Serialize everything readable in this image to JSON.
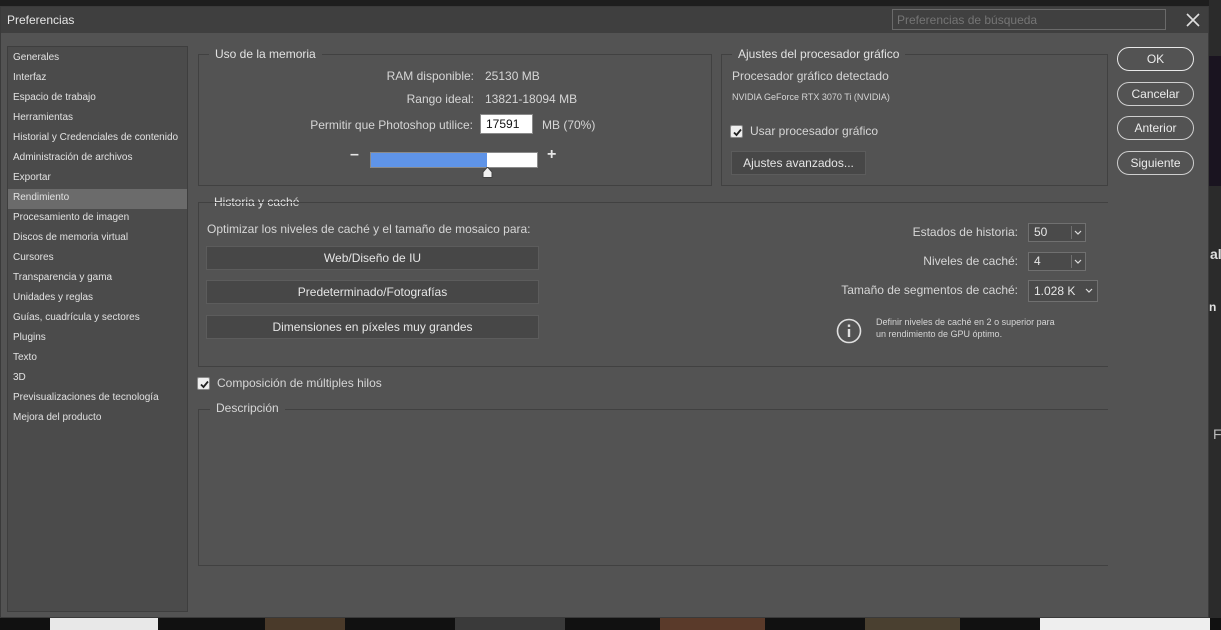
{
  "window": {
    "title": "Preferencias"
  },
  "search": {
    "placeholder": "Preferencias de búsqueda"
  },
  "sidebar": {
    "items": [
      {
        "label": "Generales"
      },
      {
        "label": "Interfaz"
      },
      {
        "label": "Espacio de trabajo"
      },
      {
        "label": "Herramientas"
      },
      {
        "label": "Historial y Credenciales de contenido"
      },
      {
        "label": "Administración de archivos"
      },
      {
        "label": "Exportar"
      },
      {
        "label": "Rendimiento",
        "selected": true
      },
      {
        "label": "Procesamiento de imagen"
      },
      {
        "label": "Discos de memoria virtual"
      },
      {
        "label": "Cursores"
      },
      {
        "label": "Transparencia y gama"
      },
      {
        "label": "Unidades y reglas"
      },
      {
        "label": "Guías, cuadrícula y sectores"
      },
      {
        "label": "Plugins"
      },
      {
        "label": "Texto"
      },
      {
        "label": "3D"
      },
      {
        "label": "Previsualizaciones de tecnología"
      },
      {
        "label": "Mejora del producto"
      }
    ]
  },
  "memory": {
    "title": "Uso de la memoria",
    "ram_label": "RAM disponible:",
    "ram_value": "25130 MB",
    "ideal_label": "Rango ideal:",
    "ideal_value": "13821-18094 MB",
    "allow_label": "Permitir que Photoshop utilice:",
    "allow_value": "17591",
    "allow_unit": "MB (70%)",
    "slider_fraction": 0.7,
    "minus": "–",
    "plus": "+"
  },
  "gpu": {
    "title": "Ajustes del procesador gráfico",
    "detected_label": "Procesador gráfico detectado",
    "gpu_name": "NVIDIA GeForce RTX 3070 Ti (NVIDIA)",
    "use_gpu_label": "Usar procesador gráfico",
    "use_gpu_checked": true,
    "advanced_button": "Ajustes avanzados..."
  },
  "history": {
    "title": "Historia y caché",
    "optimize_label": "Optimizar los niveles de caché y el tamaño de mosaico para:",
    "buttons": [
      "Web/Diseño de IU",
      "Predeterminado/Fotografías",
      "Dimensiones en píxeles muy grandes"
    ],
    "states_label": "Estados de historia:",
    "states_value": "50",
    "cache_levels_label": "Niveles de caché:",
    "cache_levels_value": "4",
    "tile_size_label": "Tamaño de segmentos de caché:",
    "tile_size_value": "1.028 K",
    "info_text": "Definir niveles de caché en 2 o superior para un rendimiento de GPU óptimo."
  },
  "multithread": {
    "label": "Composición de múltiples hilos",
    "checked": true
  },
  "description": {
    "title": "Descripción"
  },
  "actions": {
    "ok": "OK",
    "cancel": "Cancelar",
    "prev": "Anterior",
    "next": "Siguiente"
  },
  "background": {
    "fragments": [
      "al",
      "n",
      "F"
    ]
  },
  "colors": {
    "dialog_bg": "#535353",
    "slider_fill": "#5f94e8",
    "selected_item": "#6b6b6b"
  }
}
